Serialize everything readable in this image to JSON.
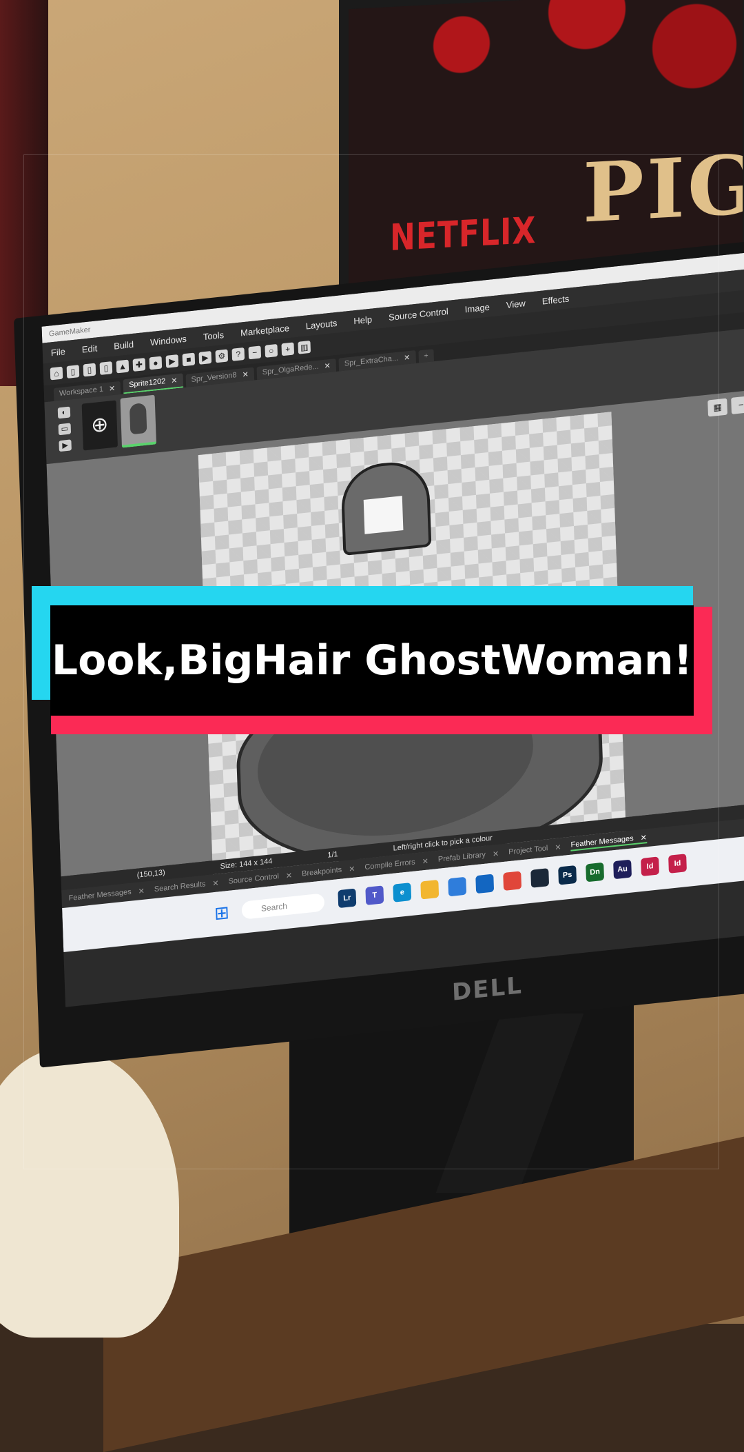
{
  "scene": {
    "poster_brand": "NETFLIX",
    "poster_title": "PIG",
    "monitor_brand": "DELL"
  },
  "app": {
    "window_title": "GameMaker",
    "menu": [
      "File",
      "Edit",
      "Build",
      "Windows",
      "Tools",
      "Marketplace",
      "Layouts",
      "Help",
      "Source Control",
      "Image",
      "View",
      "Effects"
    ],
    "tabs": [
      {
        "label": "Workspace 1",
        "active": false
      },
      {
        "label": "Sprite1202",
        "active": true
      },
      {
        "label": "Spr_Version8",
        "active": false
      },
      {
        "label": "Spr_OlgaRede...",
        "active": false
      },
      {
        "label": "Spr_ExtraCha...",
        "active": false
      }
    ],
    "status": {
      "coords": "(150,13)",
      "size": "Size: 144 x 144",
      "frame": "1/1",
      "hint": "Left/right click to pick a colour"
    },
    "bottom_tabs": [
      {
        "label": "Feather Messages",
        "active": false
      },
      {
        "label": "Search Results",
        "active": false
      },
      {
        "label": "Source Control",
        "active": false
      },
      {
        "label": "Breakpoints",
        "active": false
      },
      {
        "label": "Compile Errors",
        "active": false
      },
      {
        "label": "Prefab Library",
        "active": false
      },
      {
        "label": "Project Tool",
        "active": false
      },
      {
        "label": "Feather Messages",
        "active": true
      }
    ],
    "taskbar": {
      "search_placeholder": "Search",
      "apps": [
        {
          "icon": "lr-icon",
          "label": "Lr",
          "color": "#0f3c6e"
        },
        {
          "icon": "teams-icon",
          "label": "T",
          "color": "#5059c9"
        },
        {
          "icon": "edge-icon",
          "label": "e",
          "color": "#0c8fcf"
        },
        {
          "icon": "explorer-icon",
          "label": "",
          "color": "#f2b630"
        },
        {
          "icon": "store-icon",
          "label": "",
          "color": "#2f7ddb"
        },
        {
          "icon": "outlook-icon",
          "label": "",
          "color": "#1366c1"
        },
        {
          "icon": "chrome-icon",
          "label": "",
          "color": "#e0463a"
        },
        {
          "icon": "steam-icon",
          "label": "",
          "color": "#1b2838"
        },
        {
          "icon": "ps-icon",
          "label": "Ps",
          "color": "#0a2a4a"
        },
        {
          "icon": "dn-icon",
          "label": "Dn",
          "color": "#176b2d"
        },
        {
          "icon": "au-icon",
          "label": "Au",
          "color": "#1e1e5a"
        },
        {
          "icon": "id-icon",
          "label": "Id",
          "color": "#c4204a"
        },
        {
          "icon": "id-icon",
          "label": "Id",
          "color": "#c4204a"
        }
      ]
    }
  },
  "caption": {
    "text": "Look,BigHair GhostWoman!",
    "colors": {
      "cyan": "#25d6f0",
      "red": "#fb2a55",
      "box": "#000000",
      "text": "#ffffff"
    }
  }
}
